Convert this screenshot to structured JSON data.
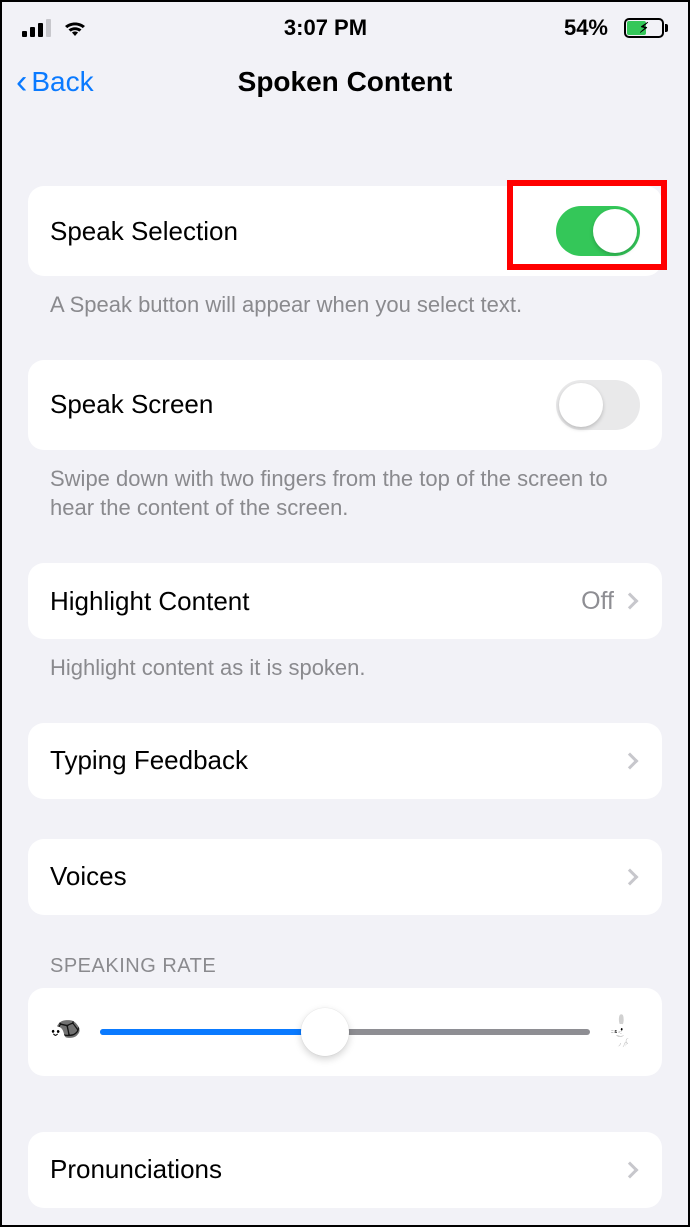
{
  "statusBar": {
    "time": "3:07 PM",
    "batteryText": "54%",
    "batteryLevel": 54
  },
  "nav": {
    "backLabel": "Back",
    "title": "Spoken Content"
  },
  "rows": {
    "speakSelection": {
      "label": "Speak Selection",
      "on": true
    },
    "speakSelectionFooter": "A Speak button will appear when you select text.",
    "speakScreen": {
      "label": "Speak Screen",
      "on": false
    },
    "speakScreenFooter": "Swipe down with two fingers from the top of the screen to hear the content of the screen.",
    "highlightContent": {
      "label": "Highlight Content",
      "value": "Off"
    },
    "highlightContentFooter": "Highlight content as it is spoken.",
    "typingFeedback": {
      "label": "Typing Feedback"
    },
    "voices": {
      "label": "Voices"
    },
    "speakingRateHeader": "SPEAKING RATE",
    "speakingRatePercent": 46,
    "pronunciations": {
      "label": "Pronunciations"
    }
  }
}
